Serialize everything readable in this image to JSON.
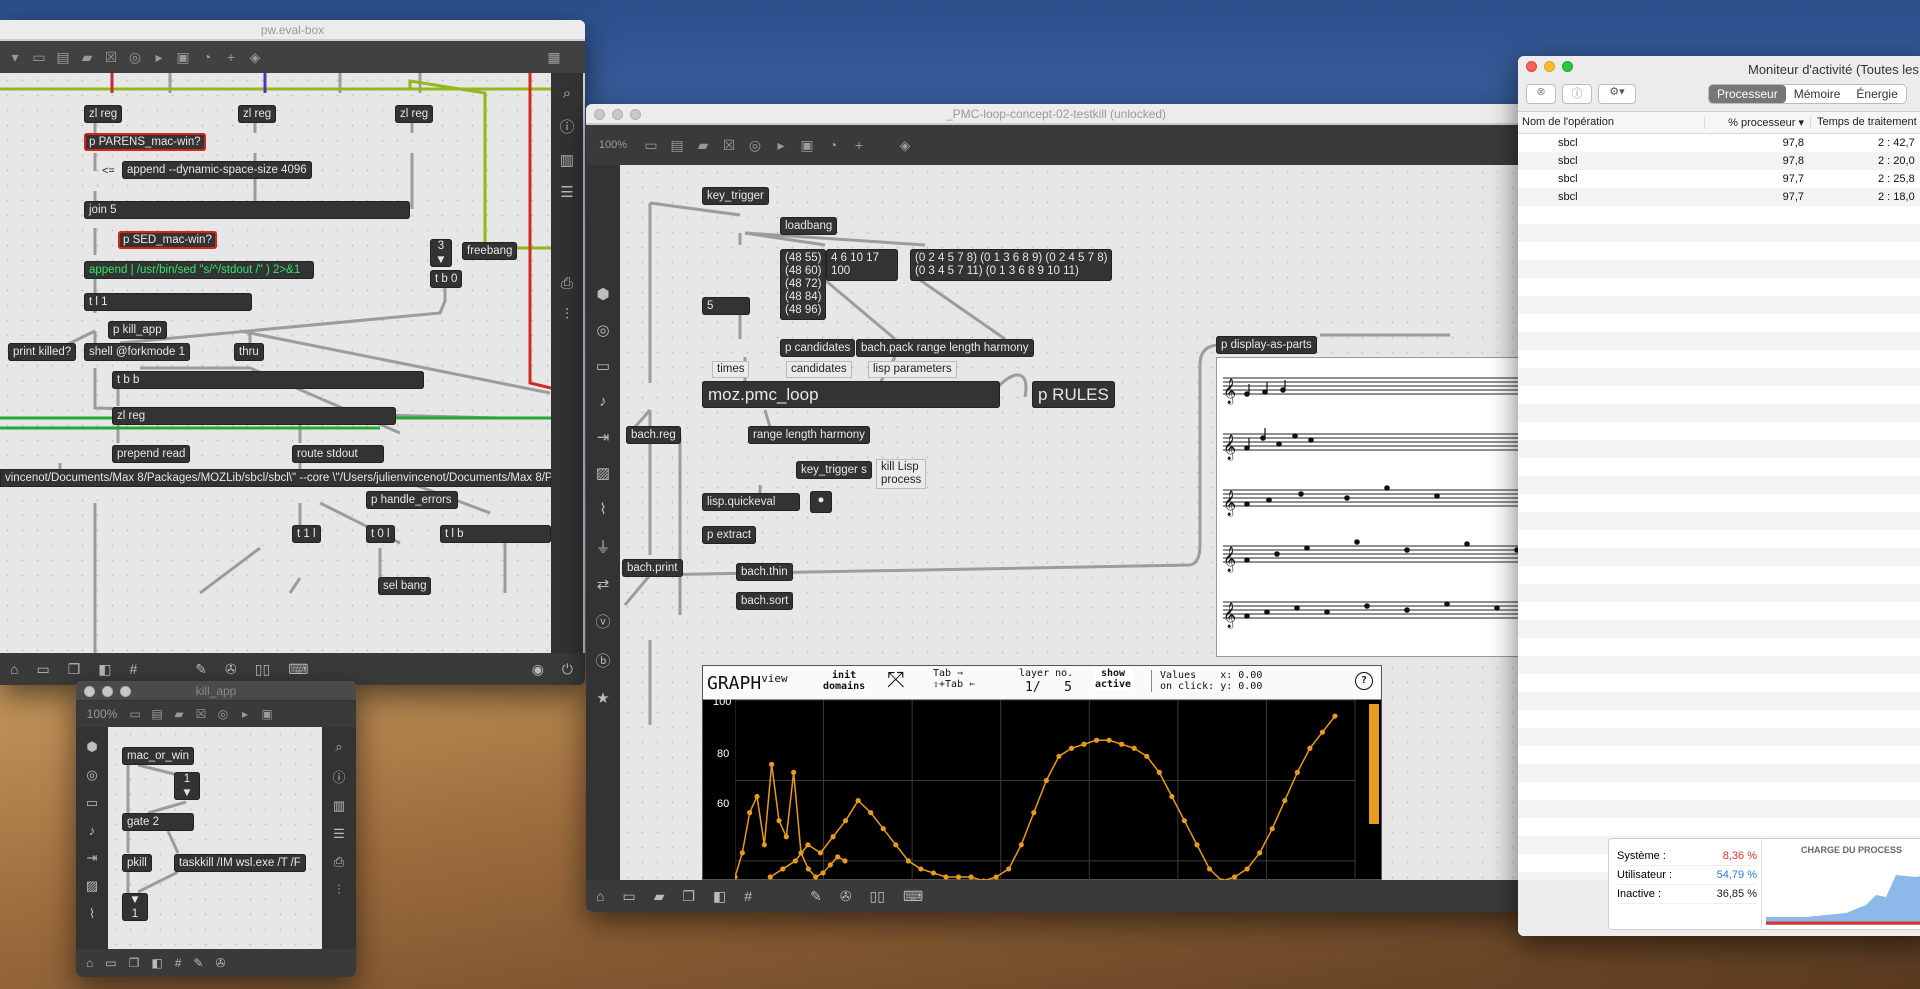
{
  "wallpaper": "desert-dunes",
  "eval_window": {
    "title": "pw.eval-box",
    "objects": [
      "zl reg",
      "zl reg",
      "zl reg",
      "p PARENS_mac-win?",
      "append --dynamic-space-size 4096",
      "join 5",
      "p SED_mac-win?",
      "freebang",
      "append | /usr/bin/sed \"s/^/stdout /\" ) 2>&1",
      "t b 0",
      "t l 1",
      "p kill_app",
      "print killed?",
      "shell @forkmode 1",
      "thru",
      "t b b",
      "zl reg",
      "prepend read",
      "route stdout",
      "p handle_errors",
      "t 1 l",
      "t 0 l",
      "t l b",
      "sel bang"
    ],
    "lt_label": "<=",
    "number_value": "3",
    "path_message": "vincenot/Documents/Max 8/Packages/MOZLib/sbcl/sbcl\\\" --core \\\"/Users/julienvincenot/Documents/Max 8/P"
  },
  "kill_window": {
    "title": "kill_app",
    "zoom": "100%",
    "objects": [
      "mac_or_win",
      "gate 2",
      "pkill",
      "taskkill /IM wsl.exe /T /F"
    ],
    "number_value": "1",
    "number_value_2": "1"
  },
  "pmc_window": {
    "title": "_PMC-loop-concept-02-testkill (unlocked)",
    "zoom": "100%",
    "objects": {
      "key_trigger": "key_trigger",
      "loadbang": "loadbang",
      "cands": "(48 55)\n(48 60)\n(48 72)\n(48 84)\n(48 96)",
      "msg2": "4 6 10 17\n100",
      "msg3": "(0 2 4 5 7 8) (0 1 3 6 8 9) (0 2 4 5 7 8)\n(0 3 4 5 7 11) (0 1 3 6 8 9 10 11)",
      "five": "5",
      "p_cand": "p candidates",
      "bach_pack": "bach.pack range length harmony",
      "moz": "moz.pmc_loop",
      "rules": "p RULES",
      "bach_reg": "bach.reg",
      "rlh": "range length harmony",
      "kts": "key_trigger s",
      "quickeval": "lisp.quickeval",
      "extract": "p extract",
      "print": "bach.print",
      "thin": "bach.thin",
      "sort": "bach.sort",
      "display": "p display-as-parts"
    },
    "comments": {
      "times": "times",
      "candidates": "candidates",
      "lisp_params": "lisp parameters",
      "kill": "kill Lisp\nprocess"
    },
    "graph": {
      "title": "GRAPH",
      "title_suffix": "view",
      "init": "init\ndomains",
      "tab": "Tab ⇒\n⇧+Tab ⇐",
      "layer_label": "layer no.",
      "layer_val": "1/   5",
      "show": "show\nactive",
      "values": "Values    x: 0.00\non click: y: 0.00",
      "help": "?",
      "ymax": "100",
      "y80": "80",
      "y60": "60"
    }
  },
  "chart_data": {
    "type": "line",
    "title": "",
    "xlabel": "",
    "ylabel": "",
    "ylim": [
      55,
      100
    ],
    "yticks": [
      60,
      80,
      100
    ],
    "series": [
      {
        "values": [
          56,
          58,
          60,
          64,
          62,
          66,
          70,
          75,
          72,
          68,
          64,
          60,
          58,
          57,
          56,
          56,
          56,
          55,
          56,
          58,
          64,
          72,
          80,
          86,
          88,
          89,
          90,
          90,
          89,
          88,
          86,
          82,
          76,
          70,
          64,
          58,
          55,
          56,
          58,
          62,
          68,
          75,
          82,
          88,
          92,
          96
        ]
      },
      {
        "values": [
          56,
          62,
          72,
          76,
          64,
          84,
          70,
          66,
          82,
          62,
          58,
          56,
          57,
          59,
          61,
          60
        ]
      }
    ],
    "color": "#e89a1a"
  },
  "activity_monitor": {
    "title": "Moniteur d'activité (Toutes les",
    "tabs": [
      "Processeur",
      "Mémoire",
      "Énergie"
    ],
    "active_tab": "Processeur",
    "columns": [
      "Nom de l'opération",
      "% processeur",
      "Temps de traitement"
    ],
    "rows": [
      {
        "name": "sbcl",
        "cpu": "97,8",
        "time": "2 : 42,7"
      },
      {
        "name": "sbcl",
        "cpu": "97,8",
        "time": "2 : 20,0"
      },
      {
        "name": "sbcl",
        "cpu": "97,7",
        "time": "2 : 25,8"
      },
      {
        "name": "sbcl",
        "cpu": "97,7",
        "time": "2 : 18,0"
      }
    ],
    "stats": [
      {
        "label": "Système :",
        "value": "8,36 %",
        "color": "#e0332b"
      },
      {
        "label": "Utilisateur :",
        "value": "54,79 %",
        "color": "#2c79d6"
      },
      {
        "label": "Inactive :",
        "value": "36,85 %",
        "color": "#222"
      }
    ],
    "load_title": "CHARGE DU PROCESS"
  }
}
